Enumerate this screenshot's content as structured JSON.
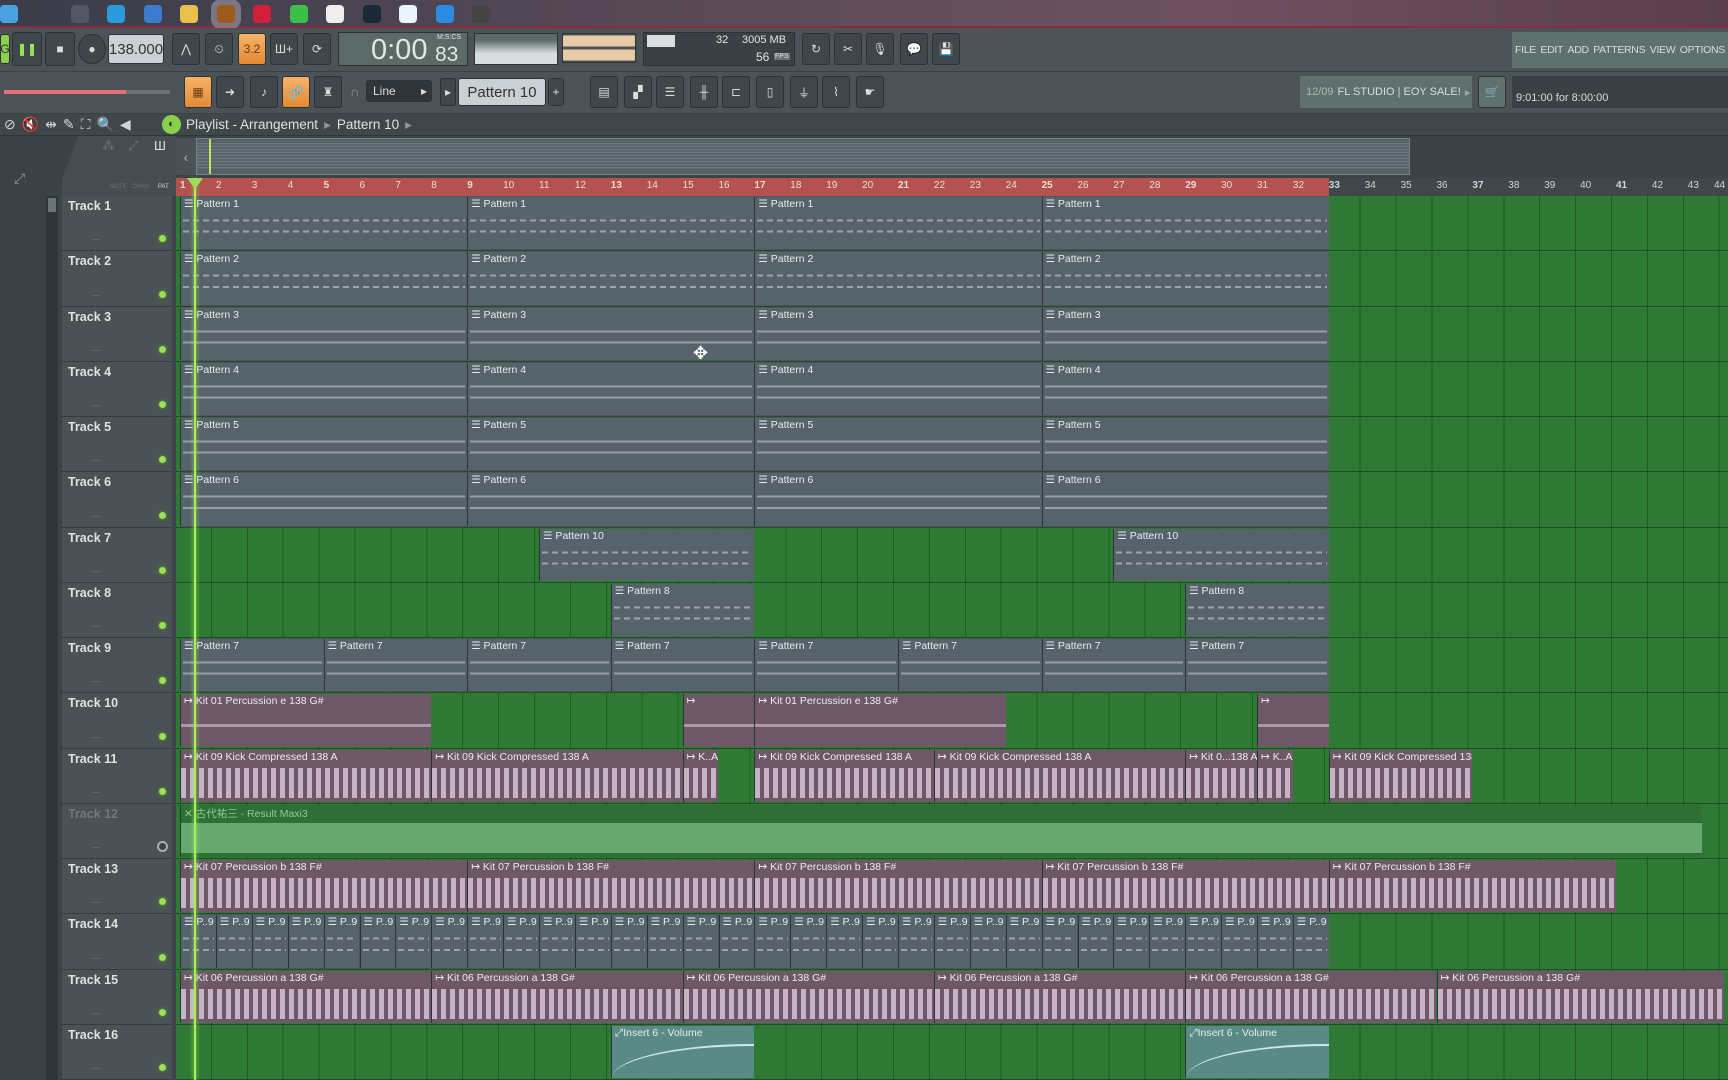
{
  "taskbar": {
    "apps": [
      "start",
      "settings",
      "edge",
      "store",
      "file-explorer",
      "fl-studio",
      "netease-music",
      "wechat",
      "trollface",
      "steam",
      "cloud-app",
      "cloud-drive",
      "obs"
    ]
  },
  "transport": {
    "pattern_mode": "G",
    "tempo": "138.000",
    "time": "0:00",
    "time_cs": "83",
    "time_format": "M:S:CS",
    "cpu": "32",
    "memory": "3005 MB",
    "poly": "56",
    "fps_label": "FPS",
    "blend_label": "3.2"
  },
  "menu": {
    "items": [
      "FILE",
      "EDIT",
      "ADD",
      "PATTERNS",
      "VIEW",
      "OPTIONS"
    ]
  },
  "toolbar2": {
    "snap": "Line",
    "pattern": "Pattern 10",
    "plus": "+"
  },
  "news": {
    "date": "12/09",
    "text": "FL STUDIO | EOY SALE!"
  },
  "hint": {
    "text": "9:01:00 for 8:00:00"
  },
  "playlist": {
    "title": "Playlist - Arrangement",
    "pattern": "Pattern 10",
    "sep": "▸",
    "filter_labels": [
      "NOTE",
      "CHAN",
      "PAT"
    ]
  },
  "ruler": {
    "bars_visible": 44,
    "pattern_end_bar": 33
  },
  "playhead_bar": 1.4,
  "colors": {
    "accent_orange": "#e48a35",
    "ruler": "#b4524f",
    "grid_green": "#2e7a35",
    "audio_clip": "#6e5868",
    "pattern_clip": "#56636a",
    "playhead": "#a5f05a"
  },
  "tracks": [
    {
      "name": "Track 1",
      "clips": [
        {
          "type": "pat",
          "label": "Pattern 1",
          "start": 1,
          "len": 8
        },
        {
          "type": "pat",
          "label": "Pattern 1",
          "start": 9,
          "len": 8
        },
        {
          "type": "pat",
          "label": "Pattern 1",
          "start": 17,
          "len": 8
        },
        {
          "type": "pat",
          "label": "Pattern 1",
          "start": 25,
          "len": 8
        }
      ]
    },
    {
      "name": "Track 2",
      "clips": [
        {
          "type": "pat",
          "label": "Pattern 2",
          "start": 1,
          "len": 8
        },
        {
          "type": "pat",
          "label": "Pattern 2",
          "start": 9,
          "len": 8
        },
        {
          "type": "pat",
          "label": "Pattern 2",
          "start": 17,
          "len": 8
        },
        {
          "type": "pat",
          "label": "Pattern 2",
          "start": 25,
          "len": 8
        }
      ]
    },
    {
      "name": "Track 3",
      "clips": [
        {
          "type": "pat lines",
          "label": "Pattern 3",
          "start": 1,
          "len": 8
        },
        {
          "type": "pat lines",
          "label": "Pattern 3",
          "start": 9,
          "len": 8
        },
        {
          "type": "pat lines",
          "label": "Pattern 3",
          "start": 17,
          "len": 8
        },
        {
          "type": "pat lines",
          "label": "Pattern 3",
          "start": 25,
          "len": 8
        }
      ]
    },
    {
      "name": "Track 4",
      "clips": [
        {
          "type": "pat lines",
          "label": "Pattern 4",
          "start": 1,
          "len": 8
        },
        {
          "type": "pat lines",
          "label": "Pattern 4",
          "start": 9,
          "len": 8
        },
        {
          "type": "pat lines",
          "label": "Pattern 4",
          "start": 17,
          "len": 8
        },
        {
          "type": "pat lines",
          "label": "Pattern 4",
          "start": 25,
          "len": 8
        }
      ]
    },
    {
      "name": "Track 5",
      "clips": [
        {
          "type": "pat lines",
          "label": "Pattern 5",
          "start": 1,
          "len": 8
        },
        {
          "type": "pat lines",
          "label": "Pattern 5",
          "start": 9,
          "len": 8
        },
        {
          "type": "pat lines",
          "label": "Pattern 5",
          "start": 17,
          "len": 8
        },
        {
          "type": "pat lines",
          "label": "Pattern 5",
          "start": 25,
          "len": 8
        }
      ]
    },
    {
      "name": "Track 6",
      "clips": [
        {
          "type": "pat lines",
          "label": "Pattern 6",
          "start": 1,
          "len": 8
        },
        {
          "type": "pat lines",
          "label": "Pattern 6",
          "start": 9,
          "len": 8
        },
        {
          "type": "pat lines",
          "label": "Pattern 6",
          "start": 17,
          "len": 8
        },
        {
          "type": "pat lines",
          "label": "Pattern 6",
          "start": 25,
          "len": 8
        }
      ]
    },
    {
      "name": "Track 7",
      "nopat": true,
      "clips": [
        {
          "type": "pat",
          "label": "Pattern 10",
          "start": 11,
          "len": 6
        },
        {
          "type": "pat",
          "label": "Pattern 10",
          "start": 27,
          "len": 6
        }
      ]
    },
    {
      "name": "Track 8",
      "nopat": true,
      "clips": [
        {
          "type": "pat",
          "label": "Pattern 8",
          "start": 13,
          "len": 4
        },
        {
          "type": "pat",
          "label": "Pattern 8",
          "start": 29,
          "len": 4
        }
      ]
    },
    {
      "name": "Track 9",
      "clips": [
        {
          "type": "pat lines",
          "label": "Pattern 7",
          "start": 1,
          "len": 4
        },
        {
          "type": "pat lines",
          "label": "Pattern 7",
          "start": 5,
          "len": 4
        },
        {
          "type": "pat lines",
          "label": "Pattern 7",
          "start": 9,
          "len": 4
        },
        {
          "type": "pat lines",
          "label": "Pattern 7",
          "start": 13,
          "len": 4
        },
        {
          "type": "pat lines",
          "label": "Pattern 7",
          "start": 17,
          "len": 4
        },
        {
          "type": "pat lines",
          "label": "Pattern 7",
          "start": 21,
          "len": 4
        },
        {
          "type": "pat lines",
          "label": "Pattern 7",
          "start": 25,
          "len": 4
        },
        {
          "type": "pat lines",
          "label": "Pattern 7",
          "start": 29,
          "len": 4
        }
      ]
    },
    {
      "name": "Track 10",
      "nopat": true,
      "clips": [
        {
          "type": "audio thin",
          "label": "Kit 01 Percussion e 138 G#",
          "start": 1,
          "len": 7
        },
        {
          "type": "audio thin",
          "label": "",
          "start": 15,
          "len": 2
        },
        {
          "type": "audio thin",
          "label": "Kit 01 Percussion e 138 G#",
          "start": 17,
          "len": 7
        },
        {
          "type": "audio thin",
          "label": "",
          "start": 31,
          "len": 2
        }
      ]
    },
    {
      "name": "Track 11",
      "nopat": true,
      "clips": [
        {
          "type": "audio",
          "label": "Kit 09 Kick Compressed 138 A",
          "start": 1,
          "len": 7
        },
        {
          "type": "audio",
          "label": "Kit 09 Kick Compressed 138 A",
          "start": 8,
          "len": 7
        },
        {
          "type": "audio",
          "label": "K..A",
          "start": 15,
          "len": 1
        },
        {
          "type": "audio",
          "label": "Kit 09 Kick Compressed 138 A",
          "start": 17,
          "len": 5
        },
        {
          "type": "audio",
          "label": "Kit 09 Kick Compressed 138 A",
          "start": 22,
          "len": 7
        },
        {
          "type": "audio",
          "label": "Kit 0...138 A",
          "start": 29,
          "len": 2
        },
        {
          "type": "audio",
          "label": "K..A",
          "start": 31,
          "len": 1
        },
        {
          "type": "audio",
          "label": "Kit 09 Kick Compressed 138 A",
          "start": 33,
          "len": 4
        }
      ]
    },
    {
      "name": "Track 12",
      "muted": true,
      "nopat": true,
      "clips": [
        {
          "type": "audiogreen",
          "label": "古代祐三 - Result Maxi3",
          "start": 1,
          "len": 42.4
        }
      ]
    },
    {
      "name": "Track 13",
      "nopat": true,
      "clips": [
        {
          "type": "audio",
          "label": "Kit 07 Percussion b 138 F#",
          "start": 1,
          "len": 8
        },
        {
          "type": "audio",
          "label": "Kit 07 Percussion b 138 F#",
          "start": 9,
          "len": 8
        },
        {
          "type": "audio",
          "label": "Kit 07 Percussion b 138 F#",
          "start": 17,
          "len": 8
        },
        {
          "type": "audio",
          "label": "Kit 07 Percussion b 138 F#",
          "start": 25,
          "len": 8
        },
        {
          "type": "audio",
          "label": "Kit 07 Percussion b 138 F#",
          "start": 33,
          "len": 8
        }
      ]
    },
    {
      "name": "Track 14",
      "repeat": {
        "type": "pat",
        "label": "P..9",
        "start": 1,
        "len": 1,
        "count": 32
      },
      "clips": []
    },
    {
      "name": "Track 15",
      "nopat": true,
      "clips": [
        {
          "type": "audio",
          "label": "Kit 06 Percussion a 138 G#",
          "start": 1,
          "len": 7
        },
        {
          "type": "audio",
          "label": "Kit 06 Percussion a 138 G#",
          "start": 8,
          "len": 7
        },
        {
          "type": "audio",
          "label": "Kit 06 Percussion a 138 G#",
          "start": 15,
          "len": 7
        },
        {
          "type": "audio",
          "label": "Kit 06 Percussion a 138 G#",
          "start": 22,
          "len": 7
        },
        {
          "type": "audio",
          "label": "Kit 06 Percussion a 138 G#",
          "start": 29,
          "len": 7
        },
        {
          "type": "audio",
          "label": "Kit 06 Percussion a 138 G#",
          "start": 36,
          "len": 8
        }
      ]
    },
    {
      "name": "Track 16",
      "nopat": true,
      "clips": [
        {
          "type": "auto",
          "label": "Insert 6 - Volume",
          "start": 13,
          "len": 4
        },
        {
          "type": "auto",
          "label": "Insert 6 - Volume",
          "start": 29,
          "len": 4
        }
      ]
    }
  ]
}
